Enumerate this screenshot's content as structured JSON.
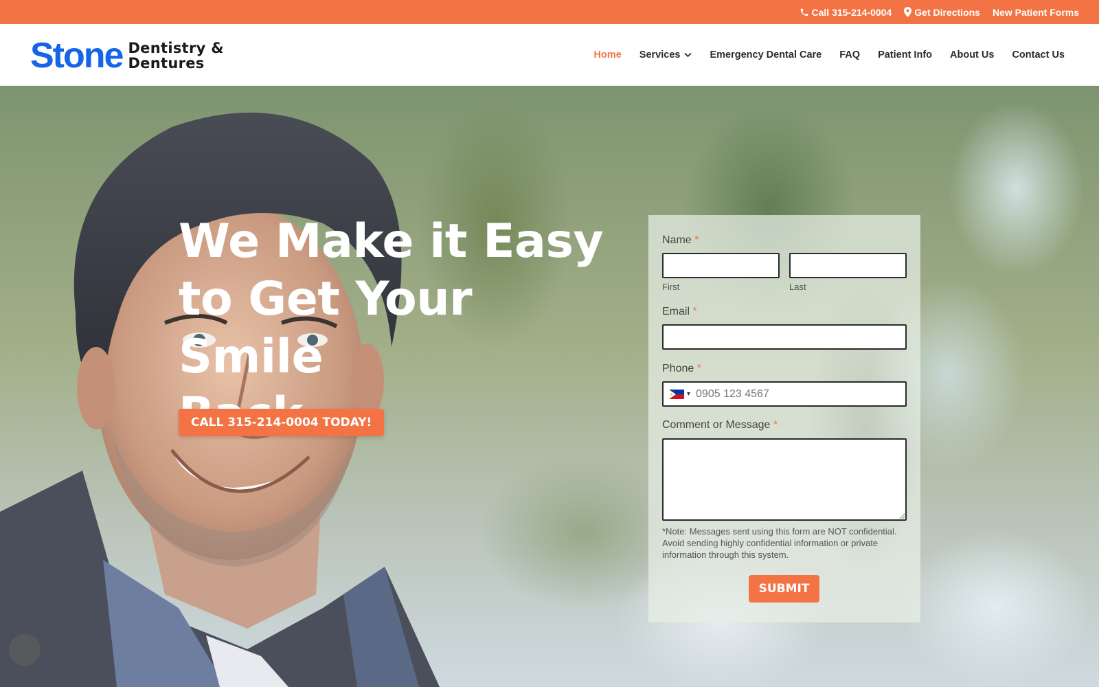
{
  "topbar": {
    "call_label": "Call 315-214-0004",
    "directions_label": "Get Directions",
    "forms_label": "New Patient Forms",
    "icons": {
      "call": "phone-icon",
      "directions": "map-marker-icon"
    }
  },
  "header": {
    "logo": {
      "word": "Stone",
      "line1": "Dentistry &",
      "line2": "Dentures"
    },
    "nav": [
      {
        "label": "Home",
        "active": true
      },
      {
        "label": "Services",
        "has_dropdown": true
      },
      {
        "label": "Emergency Dental Care"
      },
      {
        "label": "FAQ"
      },
      {
        "label": "Patient Info"
      },
      {
        "label": "About Us"
      },
      {
        "label": "Contact Us"
      }
    ]
  },
  "hero": {
    "title_lines": [
      "We Make it Easy",
      "to Get Your Smile",
      "Back"
    ],
    "cta_label": "CALL 315-214-0004 TODAY!"
  },
  "form": {
    "name_label": "Name",
    "required_mark": "*",
    "first_sub": "First",
    "last_sub": "Last",
    "email_label": "Email",
    "phone_label": "Phone",
    "phone_placeholder": "0905 123 4567",
    "phone_flag": "philippines-flag-icon",
    "message_label": "Comment or Message",
    "note": "*Note: Messages sent using this form are NOT confidential. Avoid sending highly confidential information or private information through this system.",
    "submit_label": "SUBMIT"
  },
  "colors": {
    "accent": "#f37344",
    "logo_blue": "#1565e6",
    "nav_text": "#2b2b2b"
  }
}
